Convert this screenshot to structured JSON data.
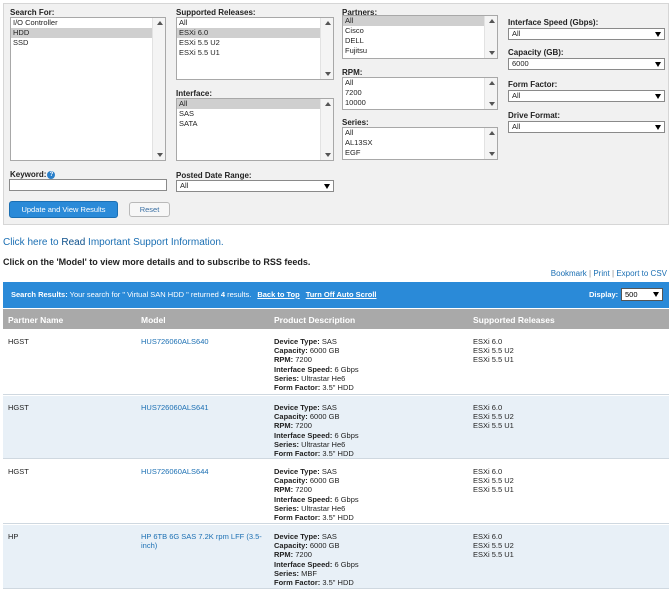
{
  "search": {
    "search_for": {
      "label": "Search For:",
      "options": [
        "I/O Controller",
        "HDD",
        "SSD"
      ],
      "selected": "HDD"
    },
    "supported_releases": {
      "label": "Supported Releases:",
      "options": [
        "All",
        "ESXi 6.0",
        "ESXi 5.5 U2",
        "ESXi 5.5 U1"
      ],
      "selected": "ESXi 6.0"
    },
    "partners": {
      "label": "Partners:",
      "options": [
        "All",
        "Cisco",
        "DELL",
        "Fujitsu"
      ],
      "selected": "All"
    },
    "interface_speed": {
      "label": "Interface Speed (Gbps):",
      "value": "All"
    },
    "capacity": {
      "label": "Capacity (GB):",
      "value": "6000"
    },
    "rpm": {
      "label": "RPM:",
      "options": [
        "All",
        "7200",
        "10000"
      ],
      "selected": ""
    },
    "form_factor": {
      "label": "Form Factor:",
      "value": "All"
    },
    "interface": {
      "label": "Interface:",
      "options": [
        "All",
        "SAS",
        "SATA"
      ],
      "selected": "All"
    },
    "series": {
      "label": "Series:",
      "options": [
        "All",
        "AL13SX",
        "EGF"
      ],
      "selected": ""
    },
    "drive_format": {
      "label": "Drive Format:",
      "value": "All"
    },
    "keyword": {
      "label": "Keyword:",
      "value": ""
    },
    "posted_date_range": {
      "label": "Posted Date Range:",
      "value": "All"
    },
    "update_button": "Update and View Results",
    "reset_button": "Reset"
  },
  "notice": {
    "prefix": "Click here to ",
    "read": "Read",
    "suffix": " Important Support Information."
  },
  "instructions": "Click on the 'Model' to view more details and to subscribe to RSS feeds.",
  "tools": {
    "bookmark": "Bookmark",
    "sep1": " | ",
    "print": "Print",
    "sep2": " | ",
    "export": "Export to CSV"
  },
  "results": {
    "label": "Search Results:",
    "text_pre": " Your search for \" Virtual SAN HDD \" returned ",
    "count": "4",
    "text_post": " results.",
    "back_to_top": "Back to Top",
    "turn_off_scroll": "Turn Off Auto Scroll",
    "display_label": "Display:",
    "display_value": "500"
  },
  "table": {
    "headers": [
      "Partner Name",
      "Model",
      "Product Description",
      "Supported Releases"
    ],
    "desc_keys": [
      "Device Type:",
      "Capacity:",
      "RPM:",
      "Interface Speed:",
      "Series:",
      "Form Factor:"
    ],
    "rows": [
      {
        "partner": "HGST",
        "model": "HUS726060ALS640",
        "desc": [
          "SAS",
          "6000 GB",
          "7200",
          "6 Gbps",
          "Ultrastar He6",
          "3.5\" HDD"
        ],
        "releases": [
          "ESXi 6.0",
          "ESXi 5.5 U2",
          "ESXi 5.5 U1"
        ]
      },
      {
        "partner": "HGST",
        "model": "HUS726060ALS641",
        "desc": [
          "SAS",
          "6000 GB",
          "7200",
          "6 Gbps",
          "Ultrastar He6",
          "3.5\" HDD"
        ],
        "releases": [
          "ESXi 6.0",
          "ESXi 5.5 U2",
          "ESXi 5.5 U1"
        ]
      },
      {
        "partner": "HGST",
        "model": "HUS726060ALS644",
        "desc": [
          "SAS",
          "6000 GB",
          "7200",
          "6 Gbps",
          "Ultrastar He6",
          "3.5\" HDD"
        ],
        "releases": [
          "ESXi 6.0",
          "ESXi 5.5 U2",
          "ESXi 5.5 U1"
        ]
      },
      {
        "partner": "HP",
        "model": "HP 6TB 6G SAS 7.2K rpm LFF (3.5-inch)",
        "desc": [
          "SAS",
          "6000 GB",
          "7200",
          "6 Gbps",
          "MBF",
          "3.5\" HDD"
        ],
        "releases": [
          "ESXi 6.0",
          "ESXi 5.5 U2",
          "ESXi 5.5 U1"
        ]
      }
    ]
  },
  "colors": {
    "accent": "#2a8ad8",
    "header_gray": "#a9a9a9",
    "row_alt": "#e8f0f7",
    "link": "#1b6fb3"
  }
}
